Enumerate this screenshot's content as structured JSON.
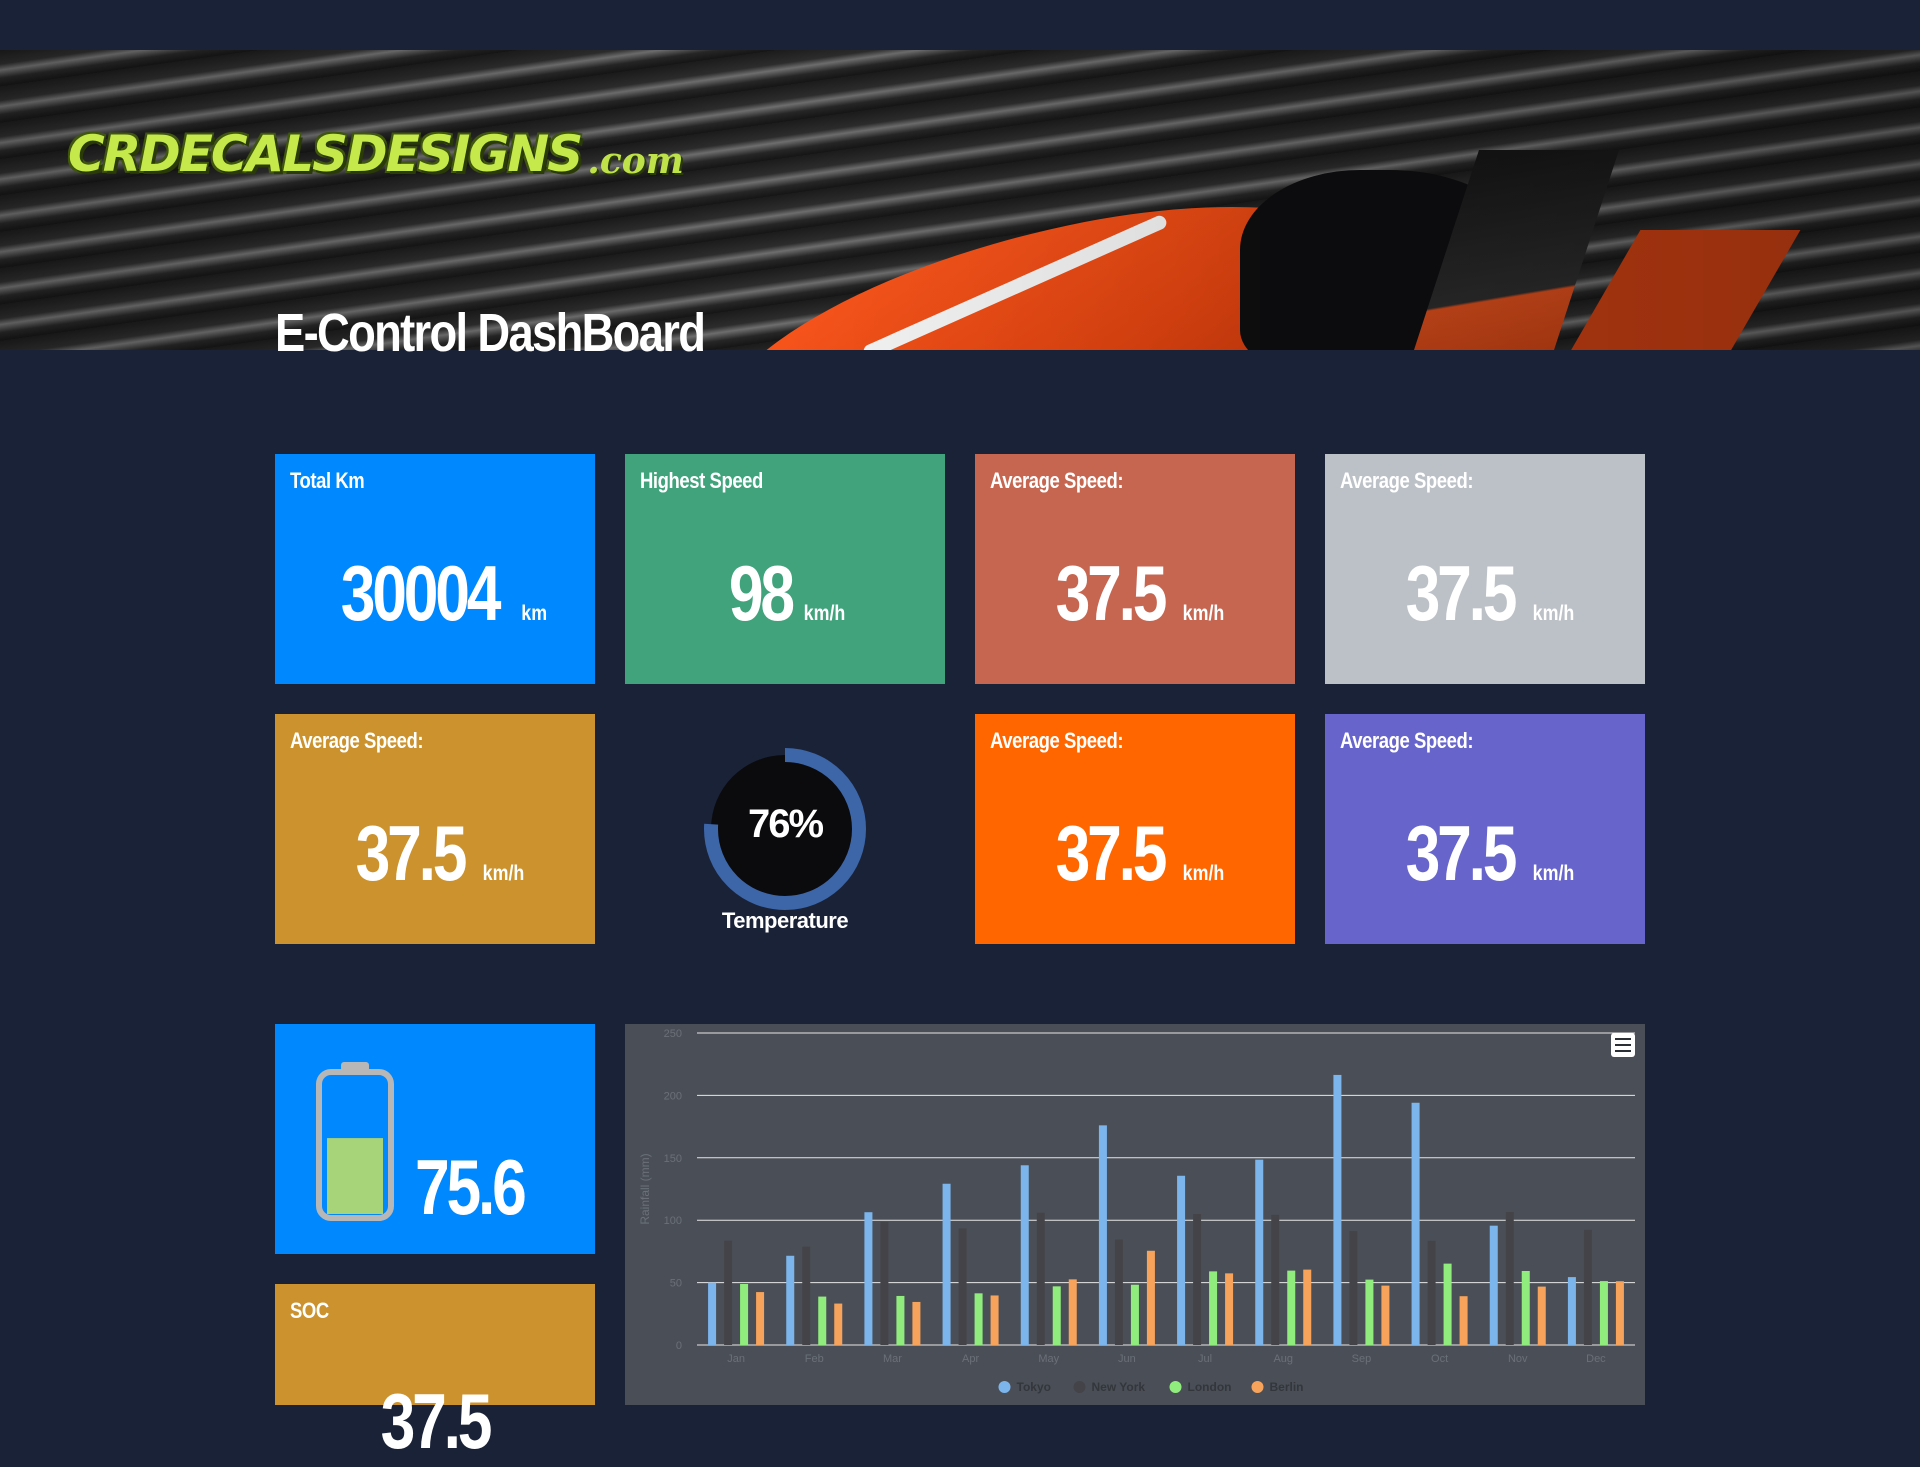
{
  "banner": {
    "logo_text": "CRDECALSDESIGNS",
    "logo_suffix": ".com"
  },
  "page_title": "E-Control DashBoard",
  "tiles": [
    {
      "label": "Total Km",
      "value": "30004",
      "unit": "km",
      "color": "#0088ff"
    },
    {
      "label": "Highest Speed",
      "value": "98",
      "unit": "km/h",
      "color": "#40a37c"
    },
    {
      "label": "Average Speed:",
      "value": "37.5",
      "unit": "km/h",
      "color": "#c66651"
    },
    {
      "label": "Average Speed:",
      "value": "37.5",
      "unit": "km/h",
      "color": "#bcc1c7"
    },
    {
      "label": "Average Speed:",
      "value": "37.5",
      "unit": "km/h",
      "color": "#cb922d"
    },
    {
      "label": "Average Speed:",
      "value": "37.5",
      "unit": "km/h",
      "color": "#ff6600"
    },
    {
      "label": "Average Speed:",
      "value": "37.5",
      "unit": "km/h",
      "color": "#6764cb"
    }
  ],
  "gauge": {
    "percent_text": "76%",
    "value": 0.76,
    "label": "Temperature",
    "track_color": "#3c66a8",
    "center_color": "#0b0b0d"
  },
  "battery": {
    "value": "75.6",
    "level": 0.55,
    "fill_color": "#a8d479"
  },
  "soc_tile": {
    "label": "SOC",
    "value": "37.5",
    "color": "#cb922d"
  },
  "chart_menu_icon": "menu-icon",
  "chart_data": {
    "type": "bar",
    "categories": [
      "Jan",
      "Feb",
      "Mar",
      "Apr",
      "May",
      "Jun",
      "Jul",
      "Aug",
      "Sep",
      "Oct",
      "Nov",
      "Dec"
    ],
    "ylabel": "Rainfall (mm)",
    "ylim": [
      0,
      250
    ],
    "yticks": [
      "0",
      "50",
      "100",
      "150",
      "200",
      "250"
    ],
    "grid": true,
    "legend": "bottom",
    "series": [
      {
        "name": "Tokyo",
        "color": "#7cb5ec",
        "values": [
          49.9,
          71.5,
          106.4,
          129.2,
          144.0,
          176.0,
          135.6,
          148.5,
          216.4,
          194.1,
          95.6,
          54.4
        ]
      },
      {
        "name": "New York",
        "color": "#434348",
        "values": [
          83.6,
          78.8,
          98.5,
          93.4,
          106.0,
          84.5,
          105.0,
          104.3,
          91.2,
          83.5,
          106.6,
          92.3
        ]
      },
      {
        "name": "London",
        "color": "#90ed7d",
        "values": [
          48.9,
          38.8,
          39.3,
          41.4,
          47.0,
          48.3,
          59.0,
          59.6,
          52.4,
          65.2,
          59.3,
          51.2
        ]
      },
      {
        "name": "Berlin",
        "color": "#f7a35c",
        "values": [
          42.4,
          33.2,
          34.5,
          39.7,
          52.6,
          75.5,
          57.4,
          60.4,
          47.6,
          39.1,
          46.8,
          51.1
        ]
      }
    ]
  }
}
